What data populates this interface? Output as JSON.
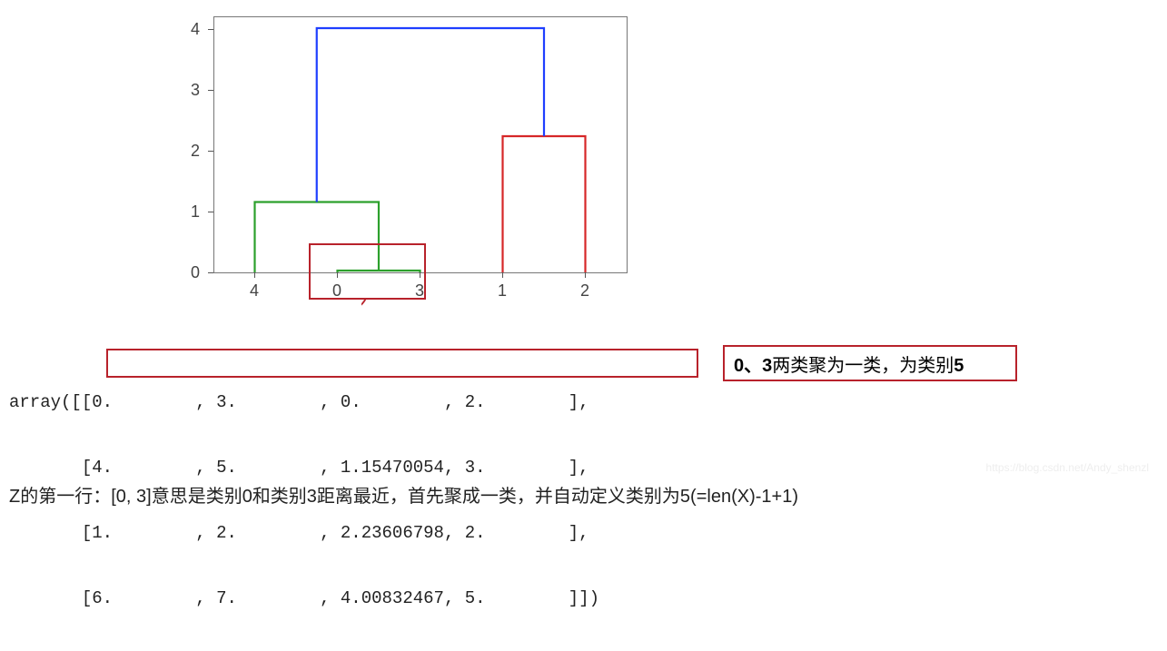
{
  "chart_data": {
    "type": "dendrogram",
    "y_ticks": [
      "0",
      "1",
      "2",
      "3",
      "4"
    ],
    "x_labels": [
      "4",
      "0",
      "3",
      "1",
      "2"
    ],
    "ylim": [
      0,
      4.2
    ],
    "nodes": [
      {
        "merge": [
          0,
          3
        ],
        "height": 0.0,
        "color": "green"
      },
      {
        "merge": [
          4,
          5
        ],
        "height": 1.15470054,
        "color": "green"
      },
      {
        "merge": [
          1,
          2
        ],
        "height": 2.23606798,
        "color": "red"
      },
      {
        "merge": [
          6,
          7
        ],
        "height": 4.00832467,
        "color": "blue"
      }
    ]
  },
  "array": {
    "prefix": "array([",
    "rows": [
      [
        "0.        ",
        "3.        ",
        "0.        ",
        "2.        "
      ],
      [
        "4.        ",
        "5.        ",
        "1.15470054",
        "3.        "
      ],
      [
        "1.        ",
        "2.        ",
        "2.23606798",
        "2.        "
      ],
      [
        "6.        ",
        "7.        ",
        "4.00832467",
        "5.        "
      ]
    ],
    "suffix": "])"
  },
  "note": {
    "prefix": "0、3",
    "mid": "两类聚为一类，为类别",
    "suffix": "5"
  },
  "caption": "Z的第一行：[0, 3]意思是类别0和类别3距离最近，首先聚成一类，并自动定义类别为5(=len(X)-1+1)",
  "watermark": "https://blog.csdn.net/Andy_shenzl"
}
